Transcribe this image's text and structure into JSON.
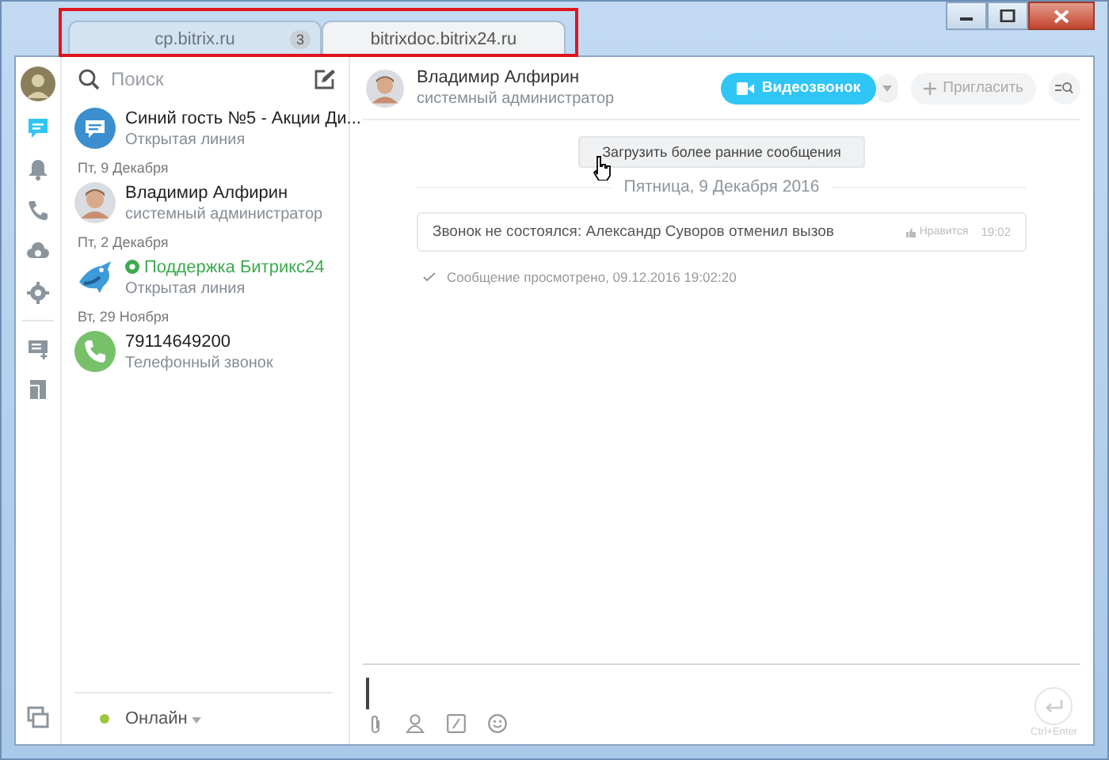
{
  "tabs": [
    {
      "label": "cp.bitrix.ru",
      "badge": "3",
      "selected": false
    },
    {
      "label": "bitrixdoc.bitrix24.ru",
      "selected": true
    }
  ],
  "rail": [
    {
      "kind": "chat",
      "selected": true
    },
    {
      "kind": "bell",
      "selected": false
    },
    {
      "kind": "phone",
      "selected": false
    },
    {
      "kind": "cloud",
      "selected": false
    },
    {
      "kind": "gear",
      "selected": false
    },
    {
      "kind": "divider"
    },
    {
      "kind": "list",
      "selected": false
    },
    {
      "kind": "book",
      "selected": false
    }
  ],
  "search": {
    "placeholder": "Поиск"
  },
  "recent": [
    {
      "kind": "chat",
      "avatar": {
        "kind": "bubble"
      },
      "title": "Синий гость №5 - Акции Ди...",
      "subtitle": "Открытая линия",
      "verified": false
    },
    {
      "kind": "date",
      "label": "Пт, 9 Декабря"
    },
    {
      "kind": "chat",
      "avatar": {
        "kind": "photo"
      },
      "title": "Владимир Алфирин",
      "subtitle": "системный администратор",
      "verified": false
    },
    {
      "kind": "date",
      "label": "Пт, 2 Декабря"
    },
    {
      "kind": "chat",
      "avatar": {
        "kind": "bird"
      },
      "title": "Поддержка Битрикс24",
      "subtitle": "Открытая линия",
      "verified": true
    },
    {
      "kind": "date",
      "label": "Вт, 29 Ноября"
    },
    {
      "kind": "chat",
      "avatar": {
        "kind": "phone"
      },
      "title": "79114649200",
      "subtitle": "Телефонный звонок",
      "verified": false
    }
  ],
  "status": {
    "label": "Онлайн",
    "kind": "online"
  },
  "header": {
    "name": "Владимир Алфирин",
    "role": "системный администратор",
    "video": "Видеозвонок",
    "invite": "Пригласить"
  },
  "chat": {
    "load_more": "Загрузить более ранние сообщения",
    "date": "Пятница, 9 Декабря 2016",
    "messages": [
      {
        "text": "Звонок не состоялся: Александр Суворов отменил вызов",
        "like": "Нравится",
        "time": "19:02"
      }
    ],
    "seen": "Сообщение просмотрено, 09.12.2016 19:02:20"
  },
  "composer": {
    "send_hint": "Ctrl+Enter"
  }
}
